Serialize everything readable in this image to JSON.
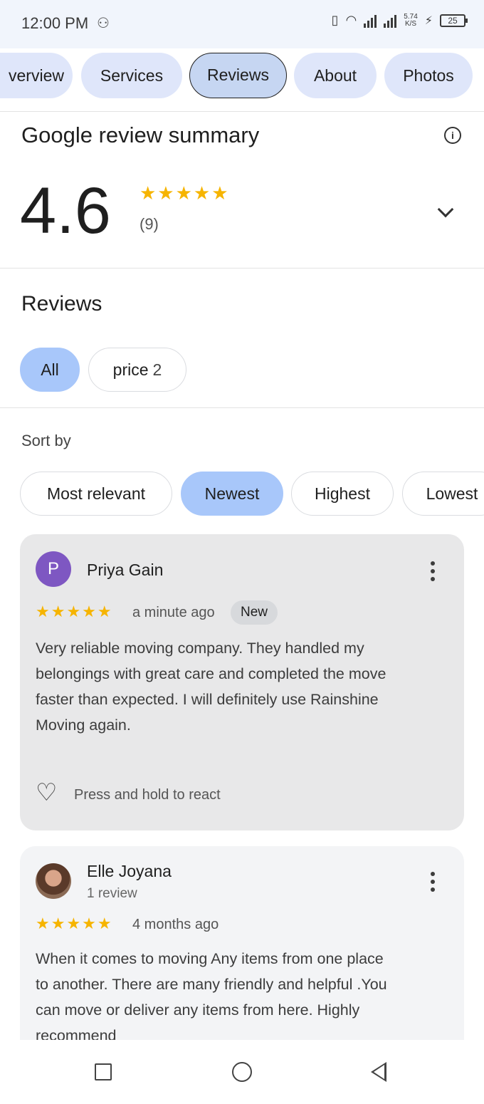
{
  "status_bar": {
    "time": "12:00 PM",
    "network_speed_value": "5.74",
    "network_speed_unit": "K/S",
    "battery": "25"
  },
  "tabs": [
    {
      "label": "Overview",
      "visible_label": "verview",
      "active": false
    },
    {
      "label": "Services",
      "active": false
    },
    {
      "label": "Reviews",
      "active": true
    },
    {
      "label": "About",
      "active": false
    },
    {
      "label": "Photos",
      "active": false
    }
  ],
  "summary": {
    "title": "Google review summary",
    "rating": "4.6",
    "stars": "★★★★★",
    "count": "(9)"
  },
  "reviews_section": {
    "title": "Reviews",
    "filters": [
      {
        "label": "All",
        "selected": true
      },
      {
        "label": "price",
        "count": "2",
        "selected": false
      }
    ],
    "sort_label": "Sort by",
    "sort_options": [
      {
        "label": "Most relevant",
        "selected": false
      },
      {
        "label": "Newest",
        "selected": true
      },
      {
        "label": "Highest",
        "selected": false
      },
      {
        "label": "Lowest",
        "selected": false
      }
    ]
  },
  "reviews": [
    {
      "avatar_letter": "P",
      "name": "Priya Gain",
      "stars": "★★★★★",
      "time": "a minute ago",
      "badge": "New",
      "text_lines": [
        "Very reliable moving company. They handled my",
        "belongings with great care and completed the move",
        "faster than expected. I will definitely use Rainshine",
        "Moving again."
      ],
      "react_label": "Press and hold to react"
    },
    {
      "name": "Elle Joyana",
      "subtitle": "1 review",
      "stars": "★★★★★",
      "time": "4 months ago",
      "text_lines": [
        "When it comes to moving Any items from one place",
        "to another. There are many friendly and helpful .You",
        "can move or deliver any items from here. Highly",
        "recommend"
      ]
    }
  ],
  "colors": {
    "star": "#f6b400",
    "selected_chip": "#a8c7fa",
    "tab_bg": "#dfe6fa",
    "avatar_purple": "#7e57c2"
  }
}
